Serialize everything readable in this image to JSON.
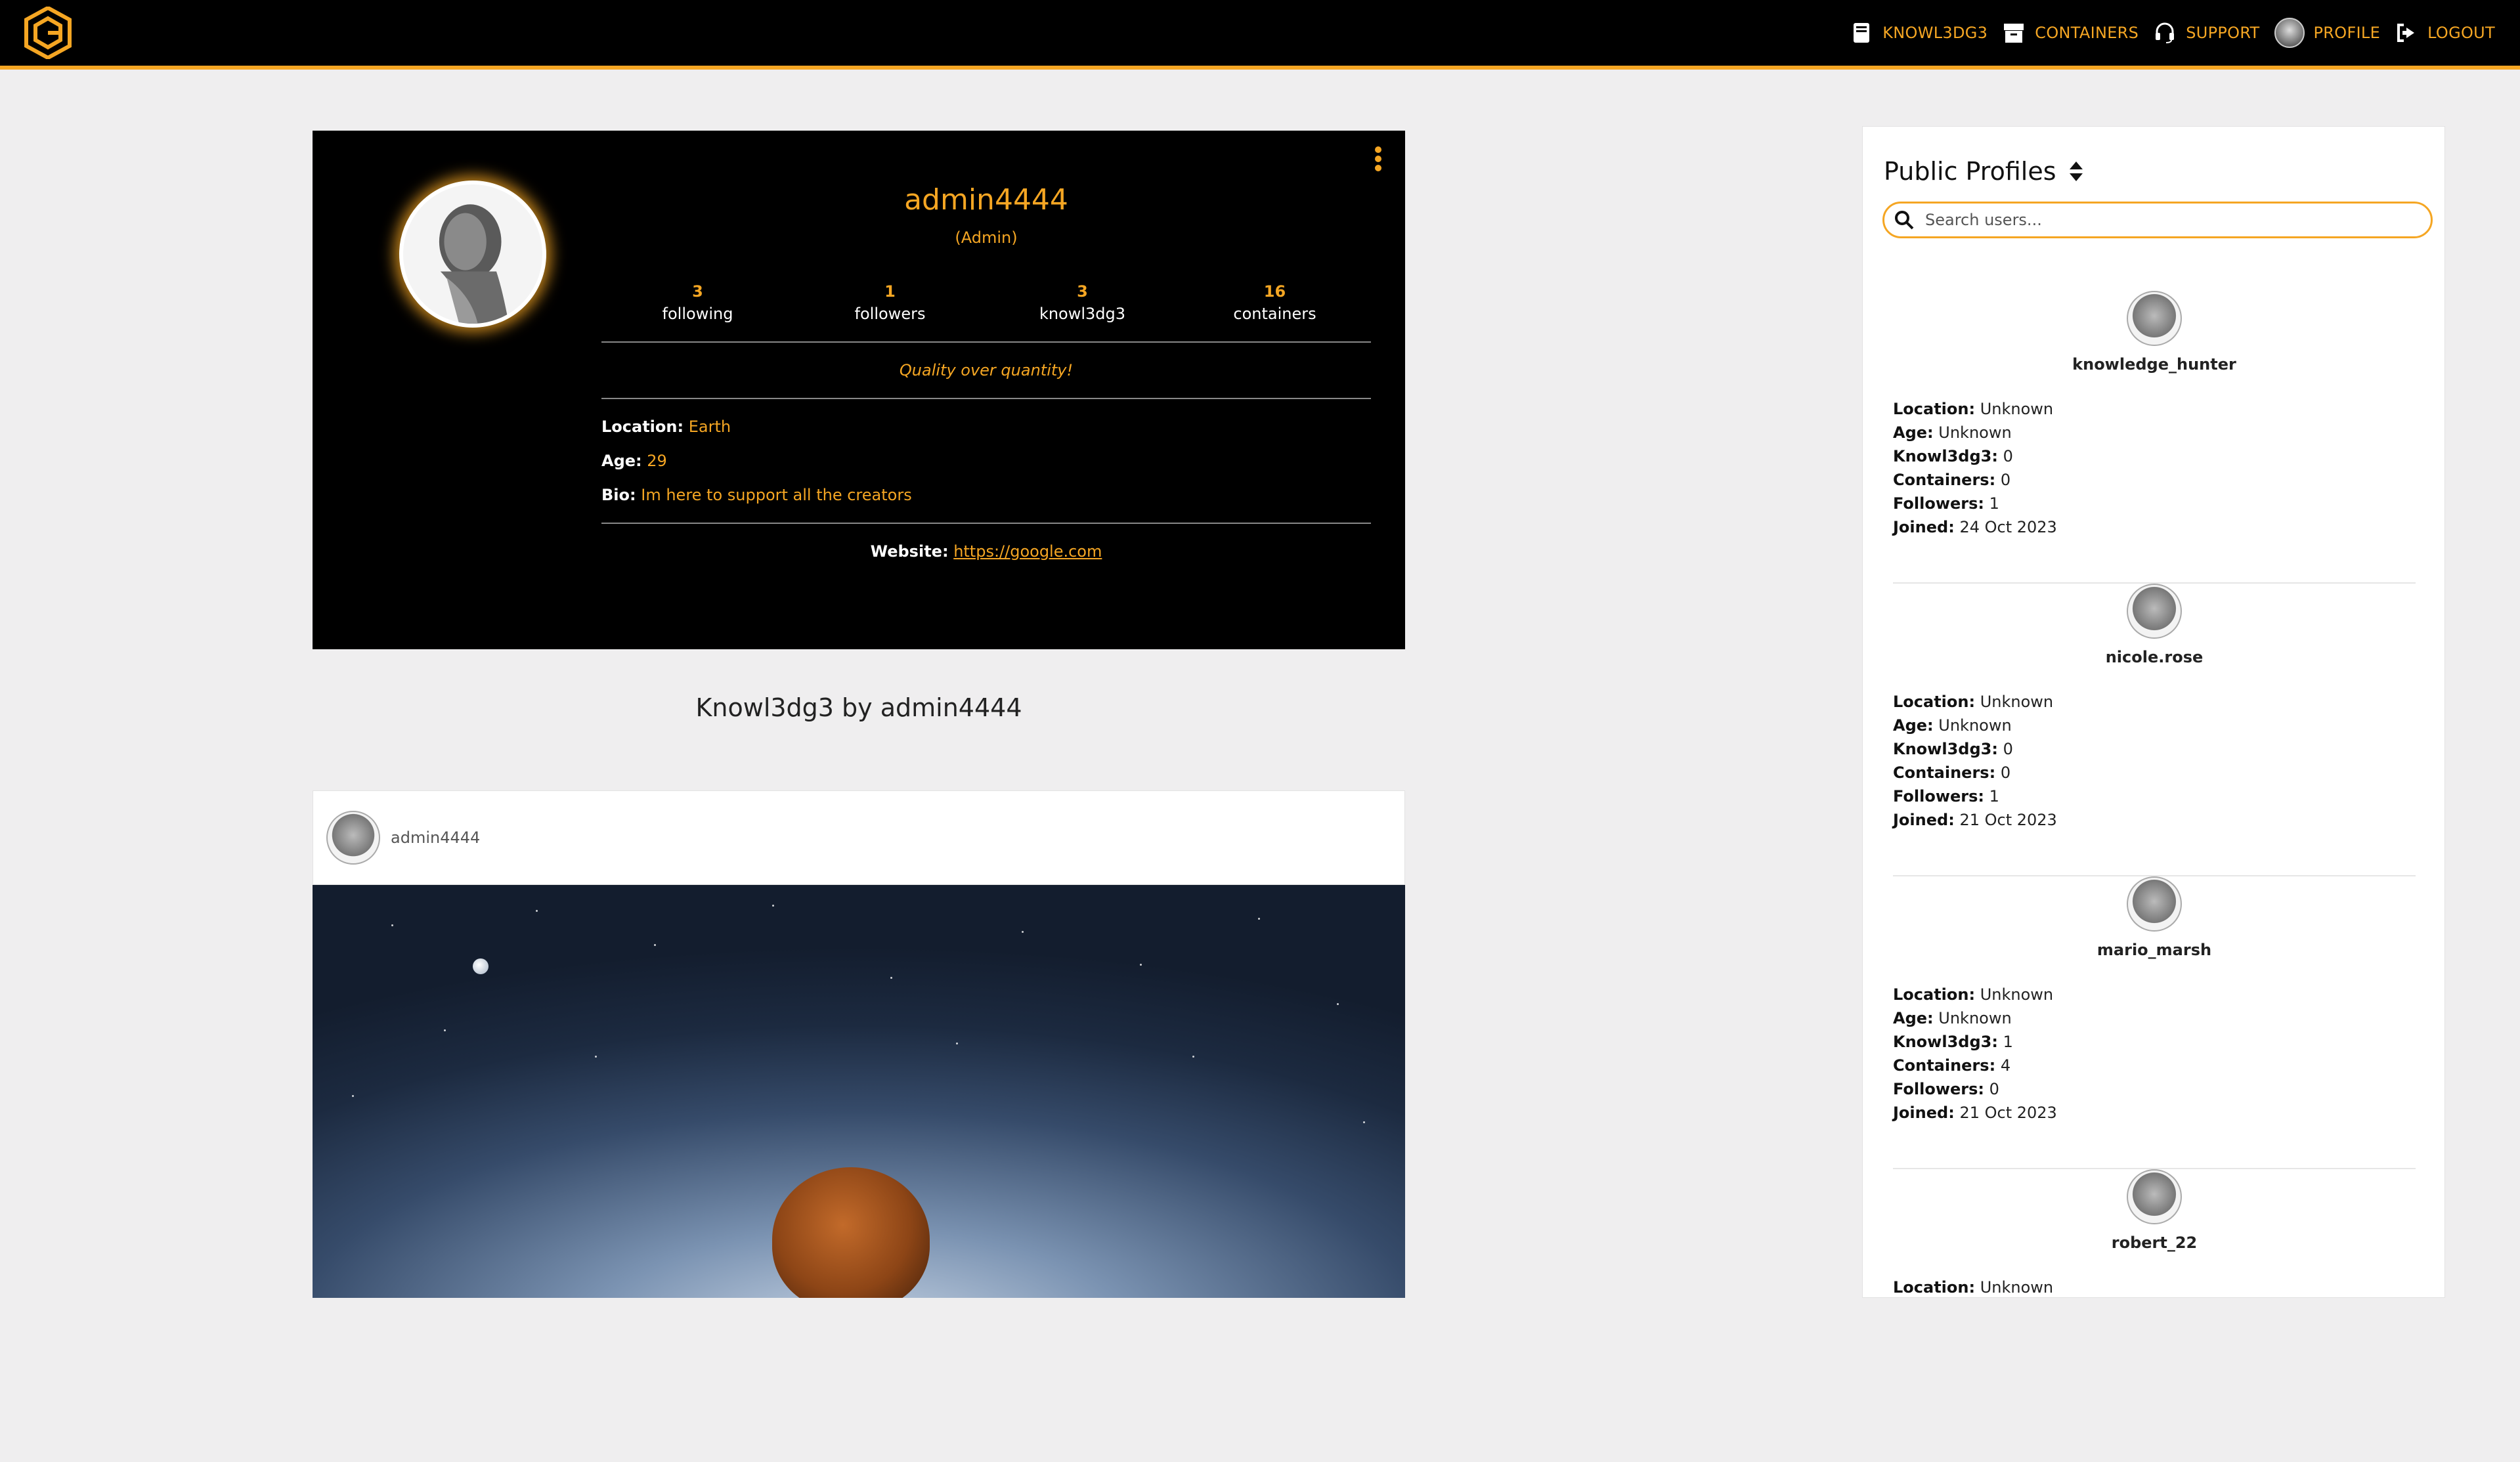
{
  "nav": {
    "links": [
      {
        "label": "KNOWL3DG3",
        "icon": "book-icon"
      },
      {
        "label": "CONTAINERS",
        "icon": "box-icon"
      },
      {
        "label": "SUPPORT",
        "icon": "headset-icon"
      },
      {
        "label": "PROFILE",
        "icon": "avatar"
      },
      {
        "label": "LOGOUT",
        "icon": "logout-icon"
      }
    ]
  },
  "profile": {
    "username": "admin4444",
    "role": "(Admin)",
    "stats": [
      {
        "value": "3",
        "label": "following"
      },
      {
        "value": "1",
        "label": "followers"
      },
      {
        "value": "3",
        "label": "knowl3dg3"
      },
      {
        "value": "16",
        "label": "containers"
      }
    ],
    "quote": "Quality over quantity!",
    "location_label": "Location:",
    "location": "Earth",
    "age_label": "Age:",
    "age": "29",
    "bio_label": "Bio:",
    "bio": "Im here to support all the creators",
    "website_label": "Website:",
    "website": "https://google.com"
  },
  "section_title": "Knowl3dg3 by admin4444",
  "post": {
    "author": "admin4444"
  },
  "sidebar": {
    "title": "Public Profiles",
    "search_placeholder": "Search users...",
    "labels": {
      "location": "Location:",
      "age": "Age:",
      "knowl3dg3": "Knowl3dg3:",
      "containers": "Containers:",
      "followers": "Followers:",
      "joined": "Joined:"
    },
    "users": [
      {
        "name": "knowledge_hunter",
        "location": "Unknown",
        "age": "Unknown",
        "knowl3dg3": "0",
        "containers": "0",
        "followers": "1",
        "joined": "24 Oct 2023"
      },
      {
        "name": "nicole.rose",
        "location": "Unknown",
        "age": "Unknown",
        "knowl3dg3": "0",
        "containers": "0",
        "followers": "1",
        "joined": "21 Oct 2023"
      },
      {
        "name": "mario_marsh",
        "location": "Unknown",
        "age": "Unknown",
        "knowl3dg3": "1",
        "containers": "4",
        "followers": "0",
        "joined": "21 Oct 2023"
      },
      {
        "name": "robert_22",
        "location": "Unknown"
      }
    ]
  },
  "colors": {
    "accent": "#f5a623",
    "nav_bg": "#000000",
    "page_bg": "#efeeef"
  }
}
